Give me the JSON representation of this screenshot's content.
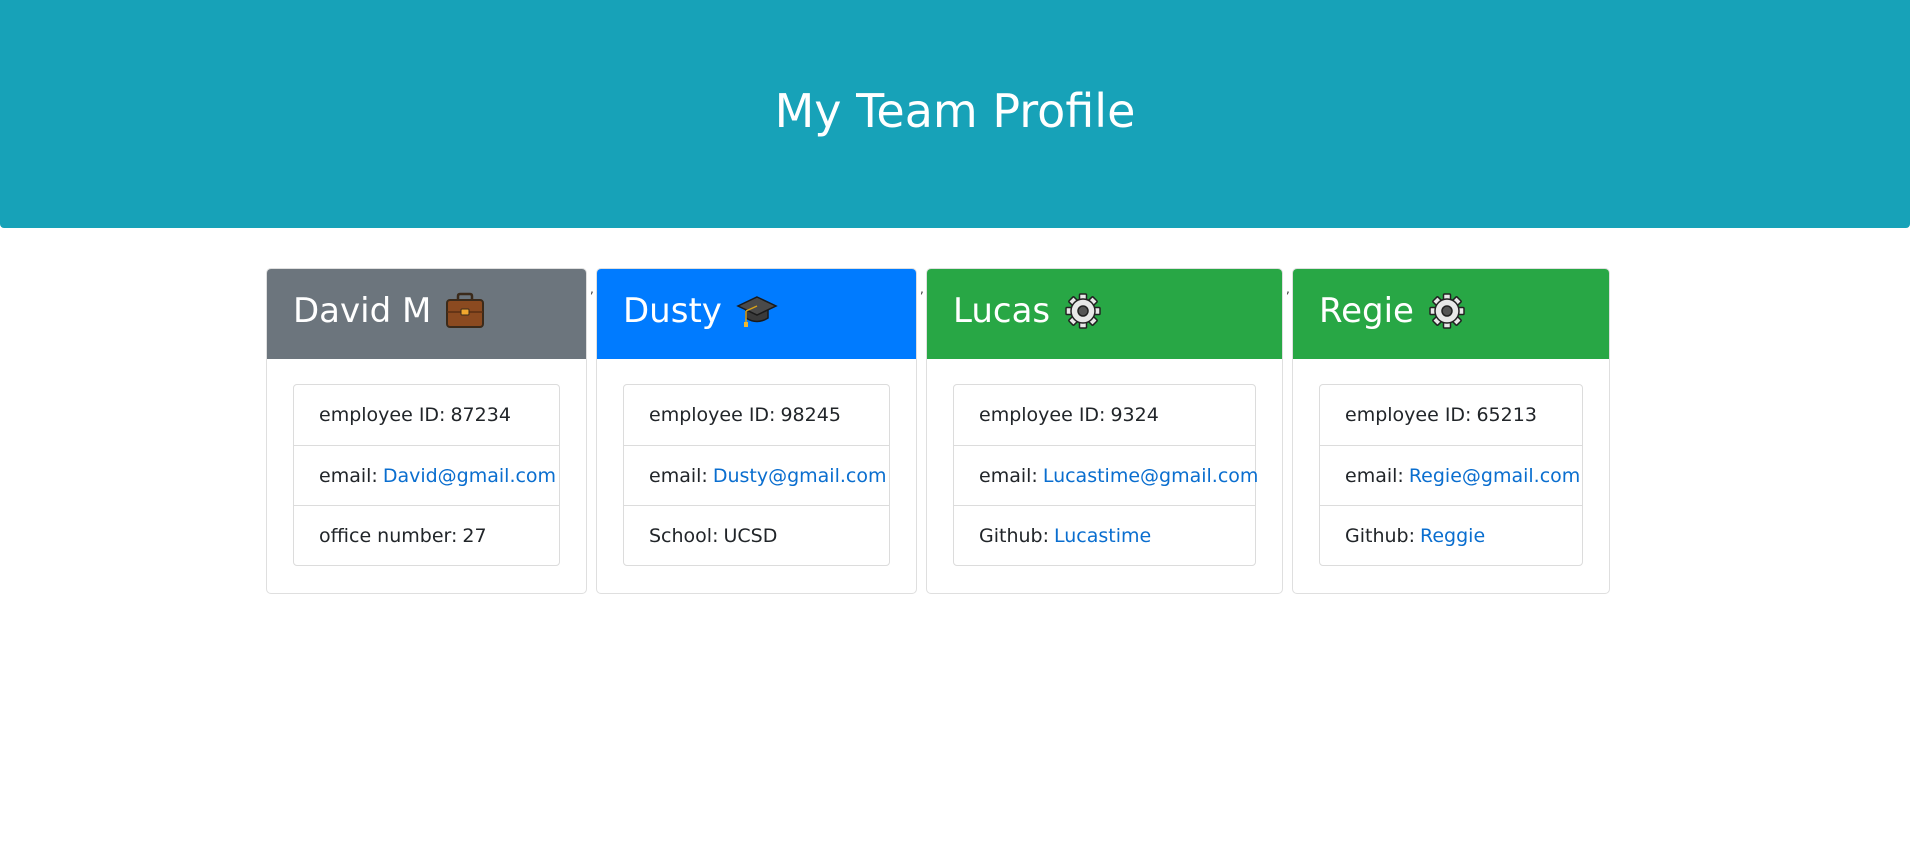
{
  "header": {
    "title": "My Team Profile"
  },
  "separator": ",",
  "team": [
    {
      "name": "David M",
      "role_icon": "briefcase-icon",
      "color": "#6c757d",
      "id_label": "employee ID:",
      "id_value": "87234",
      "email_label": "email:",
      "email": "David@gmail.com",
      "extra_label": "office number:",
      "extra_value": "27"
    },
    {
      "name": "Dusty",
      "role_icon": "graduation-cap-icon",
      "color": "#007bff",
      "id_label": "employee ID:",
      "id_value": "98245",
      "email_label": "email:",
      "email": "Dusty@gmail.com",
      "extra_label": "School:",
      "extra_value": "UCSD"
    },
    {
      "name": "Lucas",
      "role_icon": "gear-icon",
      "color": "#28a745",
      "id_label": "employee ID:",
      "id_value": "9324",
      "email_label": "email:",
      "email": "Lucastime@gmail.com",
      "extra_label": "Github:",
      "extra_value": "Lucastime"
    },
    {
      "name": "Regie",
      "role_icon": "gear-icon",
      "color": "#28a745",
      "id_label": "employee ID:",
      "id_value": "65213",
      "email_label": "email:",
      "email": "Regie@gmail.com",
      "extra_label": "Github:",
      "extra_value": "Reggie"
    }
  ]
}
